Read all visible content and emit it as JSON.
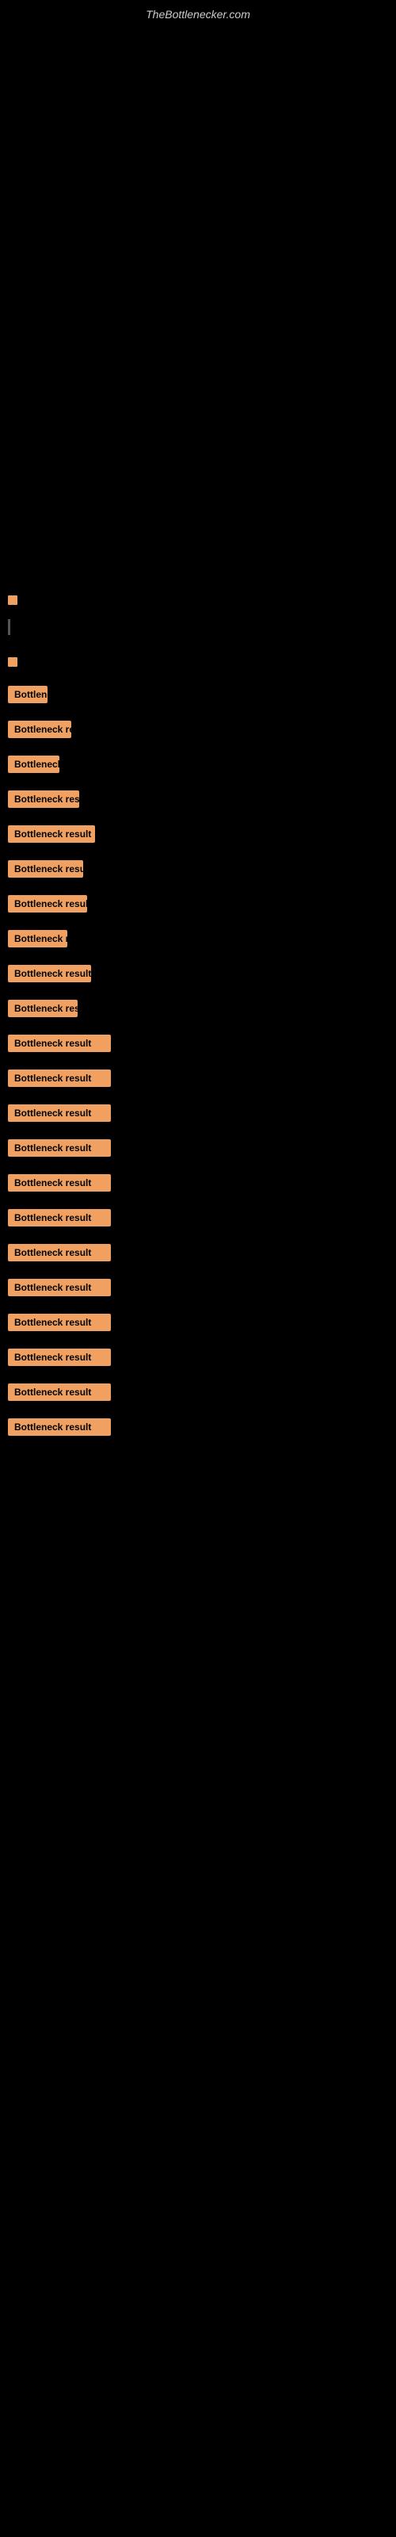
{
  "site": {
    "title": "TheBottlenecker.com"
  },
  "indicators": [
    {
      "type": "orange-dot"
    },
    {
      "type": "vertical-bar"
    },
    {
      "type": "orange-dot"
    }
  ],
  "results": [
    {
      "label": "Bottleneck result",
      "width_class": "badge-w1"
    },
    {
      "label": "Bottleneck result",
      "width_class": "badge-w2"
    },
    {
      "label": "Bottleneck result",
      "width_class": "badge-w3"
    },
    {
      "label": "Bottleneck result",
      "width_class": "badge-w4"
    },
    {
      "label": "Bottleneck result",
      "width_class": "badge-w5"
    },
    {
      "label": "Bottleneck result",
      "width_class": "badge-w6"
    },
    {
      "label": "Bottleneck result",
      "width_class": "badge-w7"
    },
    {
      "label": "Bottleneck result",
      "width_class": "badge-w8"
    },
    {
      "label": "Bottleneck result",
      "width_class": "badge-w9"
    },
    {
      "label": "Bottleneck result",
      "width_class": "badge-w10"
    },
    {
      "label": "Bottleneck result",
      "width_class": "badge-full"
    },
    {
      "label": "Bottleneck result",
      "width_class": "badge-full"
    },
    {
      "label": "Bottleneck result",
      "width_class": "badge-full"
    },
    {
      "label": "Bottleneck result",
      "width_class": "badge-full"
    },
    {
      "label": "Bottleneck result",
      "width_class": "badge-full"
    },
    {
      "label": "Bottleneck result",
      "width_class": "badge-full"
    },
    {
      "label": "Bottleneck result",
      "width_class": "badge-full"
    },
    {
      "label": "Bottleneck result",
      "width_class": "badge-full"
    },
    {
      "label": "Bottleneck result",
      "width_class": "badge-full"
    },
    {
      "label": "Bottleneck result",
      "width_class": "badge-full"
    },
    {
      "label": "Bottleneck result",
      "width_class": "badge-full"
    },
    {
      "label": "Bottleneck result",
      "width_class": "badge-full"
    }
  ]
}
